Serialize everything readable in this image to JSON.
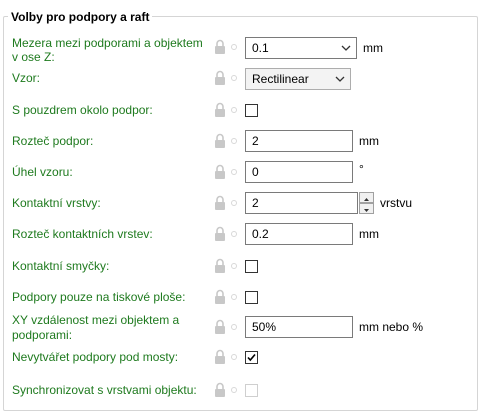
{
  "section": {
    "title": "Volby pro podpory a raft"
  },
  "fields": [
    {
      "id": "contact-distance",
      "label": "Mezera mezi podporami a objektem v ose Z:",
      "type": "select",
      "value": "0.1",
      "unit": "mm"
    },
    {
      "id": "pattern",
      "label": "Vzor:",
      "type": "select",
      "value": "Rectilinear",
      "unit": ""
    },
    {
      "id": "with-sheath",
      "label": "S pouzdrem okolo podpor:",
      "type": "checkbox",
      "checked": false
    },
    {
      "id": "spacing",
      "label": "Rozteč podpor:",
      "type": "text",
      "value": "2",
      "unit": "mm"
    },
    {
      "id": "angle",
      "label": "Úhel vzoru:",
      "type": "text",
      "value": "0",
      "unit": "°"
    },
    {
      "id": "interface-layers",
      "label": "Kontaktní vrstvy:",
      "type": "spin",
      "value": "2",
      "unit": "vrstvu"
    },
    {
      "id": "interface-spacing",
      "label": "Rozteč kontaktních vrstev:",
      "type": "text",
      "value": "0.2",
      "unit": "mm"
    },
    {
      "id": "interface-loops",
      "label": "Kontaktní smyčky:",
      "type": "checkbox",
      "checked": false
    },
    {
      "id": "buildplate-only",
      "label": "Podpory pouze na tiskové ploše:",
      "type": "checkbox",
      "checked": false
    },
    {
      "id": "xy-distance",
      "label": "XY vzdálenost mezi objektem a podporami:",
      "type": "text",
      "value": "50%",
      "unit": "mm nebo %"
    },
    {
      "id": "dont-bridge",
      "label": "Nevytvářet podpory pod mosty:",
      "type": "checkbox",
      "checked": true
    },
    {
      "id": "synchronize",
      "label": "Synchronizovat s vrstvami objektu:",
      "type": "checkbox",
      "checked": false,
      "disabled": true
    }
  ],
  "colors": {
    "label": "#1e7a1e",
    "border": "#7a7a7a"
  },
  "icons": {
    "lock": "lock-icon",
    "dot": "dot-icon"
  }
}
